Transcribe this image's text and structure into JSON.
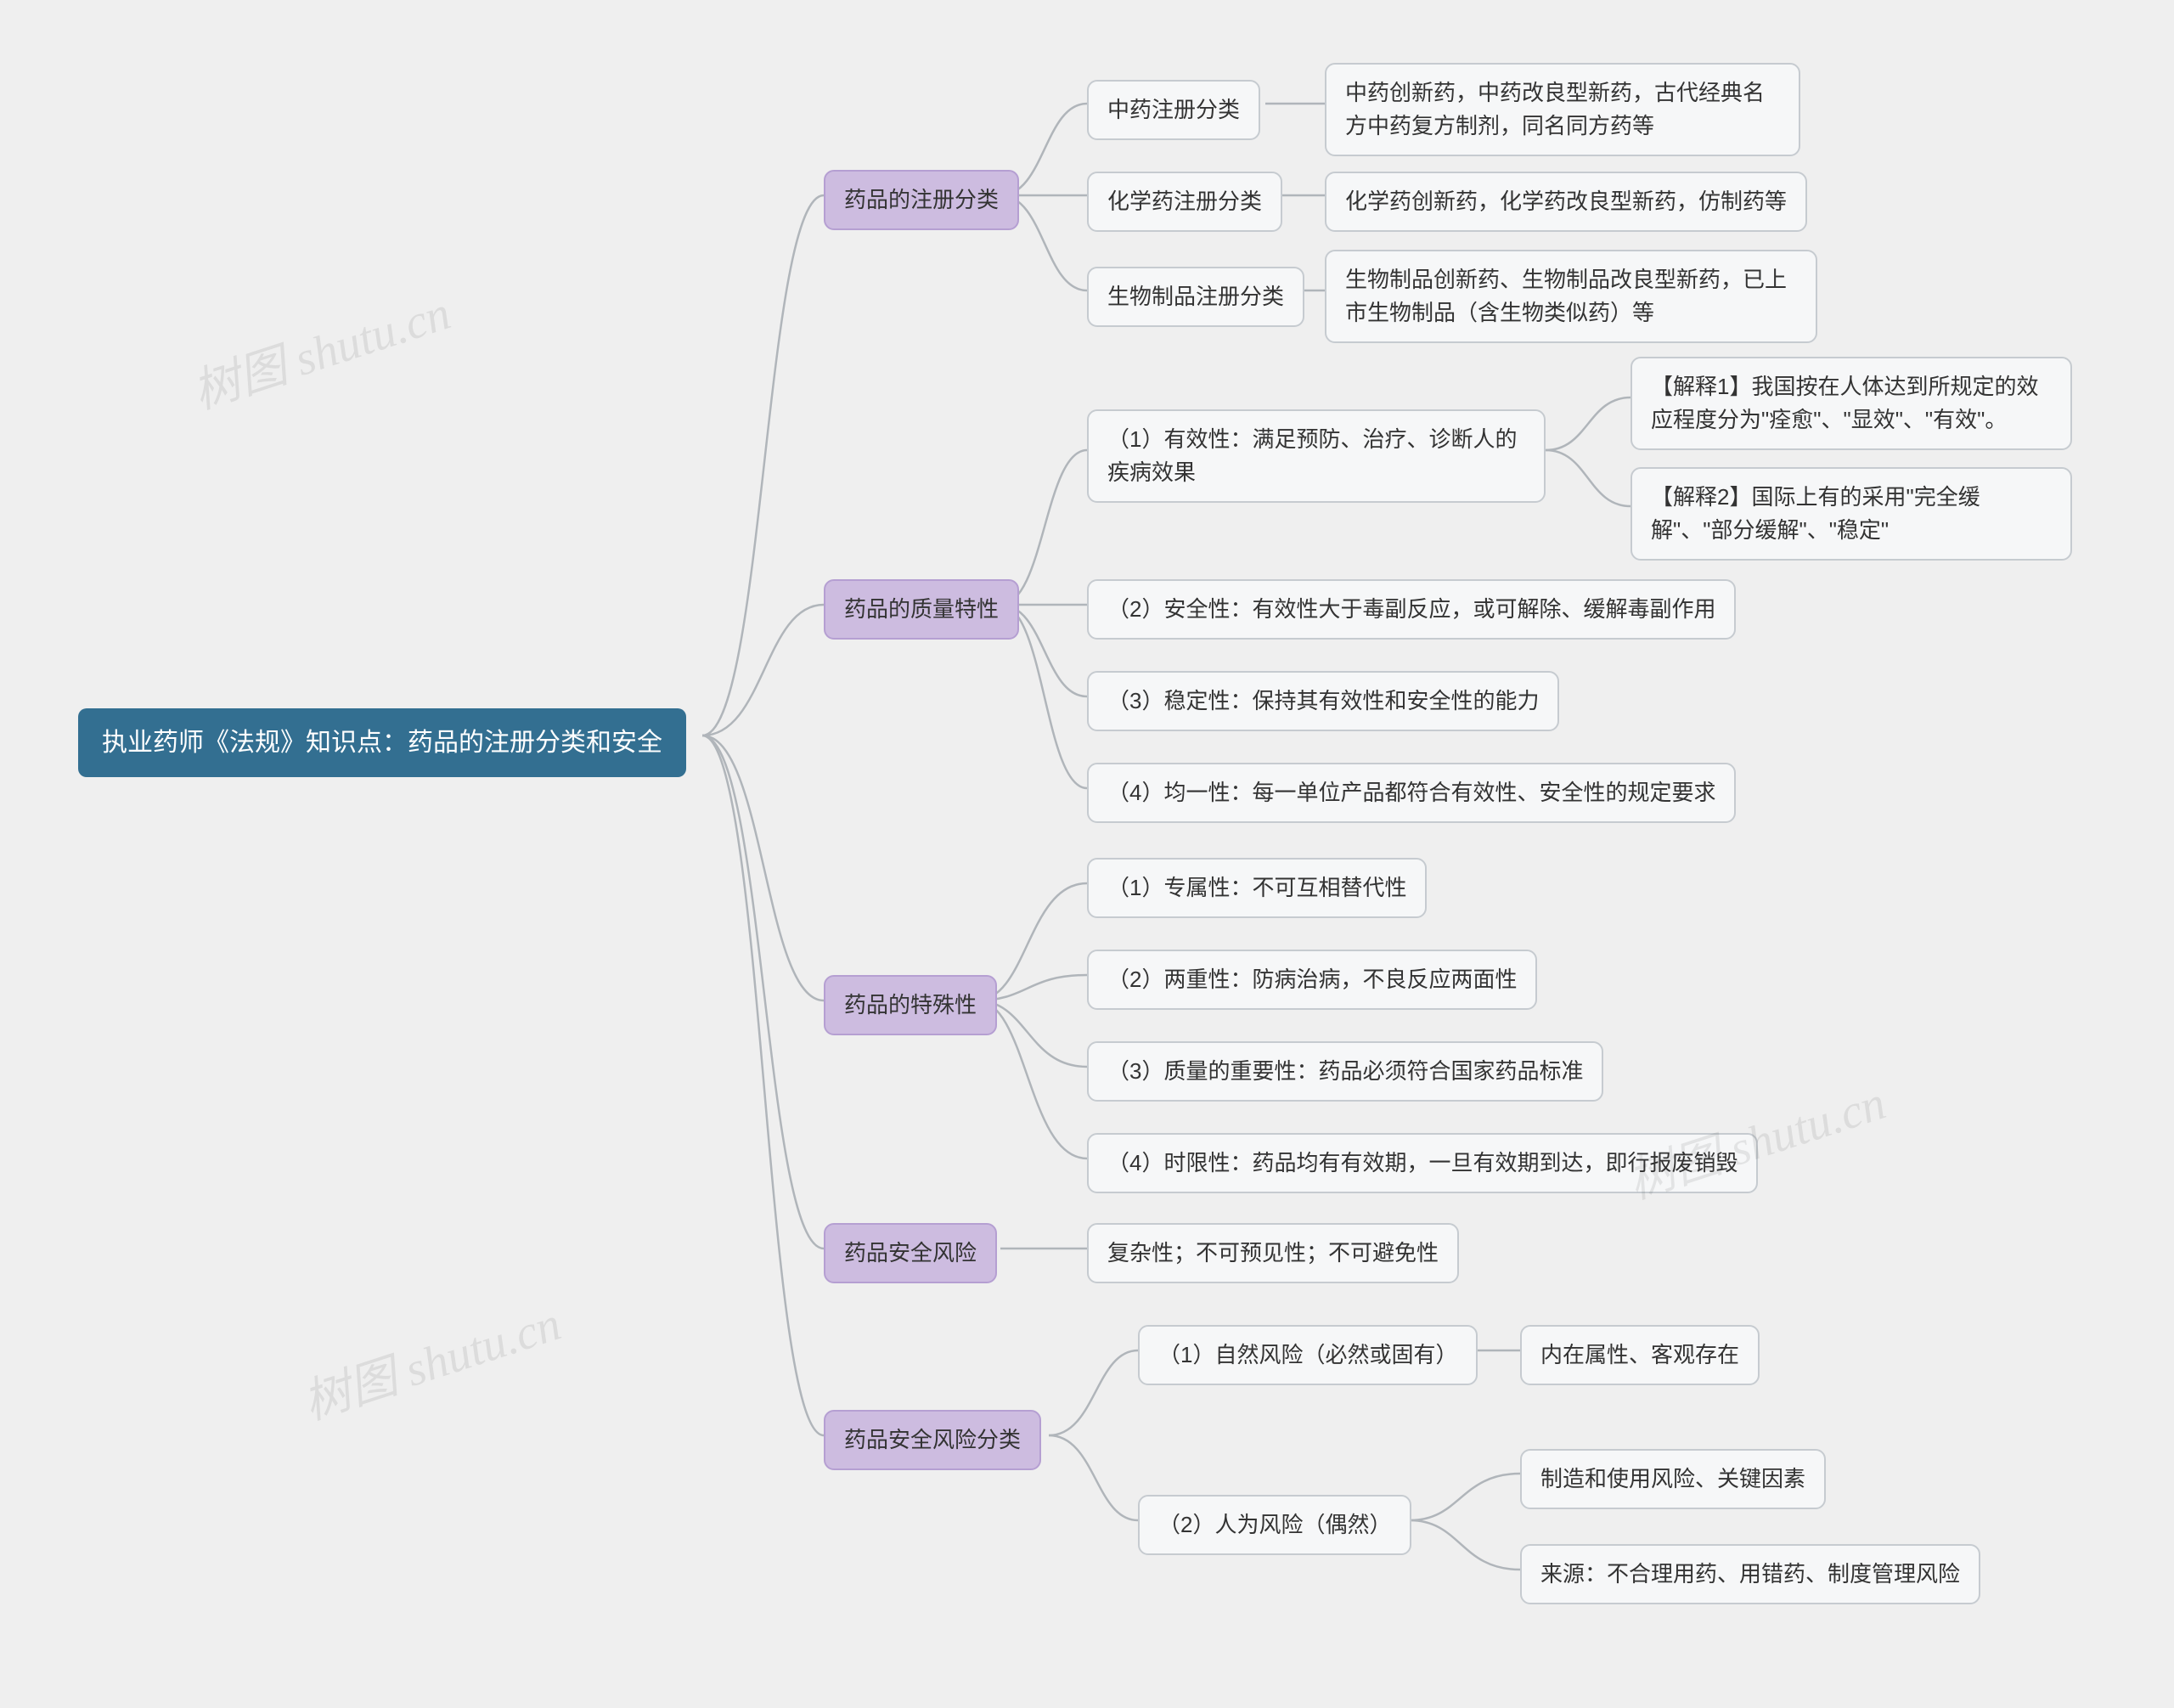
{
  "root": "执业药师《法规》知识点：药品的注册分类和安全",
  "cat1": "药品的注册分类",
  "c1a": "中药注册分类",
  "c1a_d": "中药创新药，中药改良型新药，古代经典名方中药复方制剂，同名同方药等",
  "c1b": "化学药注册分类",
  "c1b_d": "化学药创新药，化学药改良型新药，仿制药等",
  "c1c": "生物制品注册分类",
  "c1c_d": "生物制品创新药、生物制品改良型新药，已上市生物制品（含生物类似药）等",
  "cat2": "药品的质量特性",
  "c2a": "（1）有效性：满足预防、治疗、诊断人的疾病效果",
  "c2a_e1": "【解释1】我国按在人体达到所规定的效应程度分为\"痊愈\"、\"显效\"、\"有效\"。",
  "c2a_e2": "【解释2】国际上有的采用\"完全缓解\"、\"部分缓解\"、\"稳定\"",
  "c2b": "（2）安全性：有效性大于毒副反应，或可解除、缓解毒副作用",
  "c2c": "（3）稳定性：保持其有效性和安全性的能力",
  "c2d": "（4）均一性：每一单位产品都符合有效性、安全性的规定要求",
  "cat3": "药品的特殊性",
  "c3a": "（1）专属性：不可互相替代性",
  "c3b": "（2）两重性：防病治病，不良反应两面性",
  "c3c": "（3）质量的重要性：药品必须符合国家药品标准",
  "c3d": "（4）时限性：药品均有有效期，一旦有效期到达，即行报废销毁",
  "cat4": "药品安全风险",
  "c4a": "复杂性；不可预见性；不可避免性",
  "cat5": "药品安全风险分类",
  "c5a": "（1）自然风险（必然或固有）",
  "c5a_d": "内在属性、客观存在",
  "c5b": "（2）人为风险（偶然）",
  "c5b_d1": "制造和使用风险、关键因素",
  "c5b_d2": "来源：不合理用药、用错药、制度管理风险",
  "watermark": "树图 shutu.cn"
}
